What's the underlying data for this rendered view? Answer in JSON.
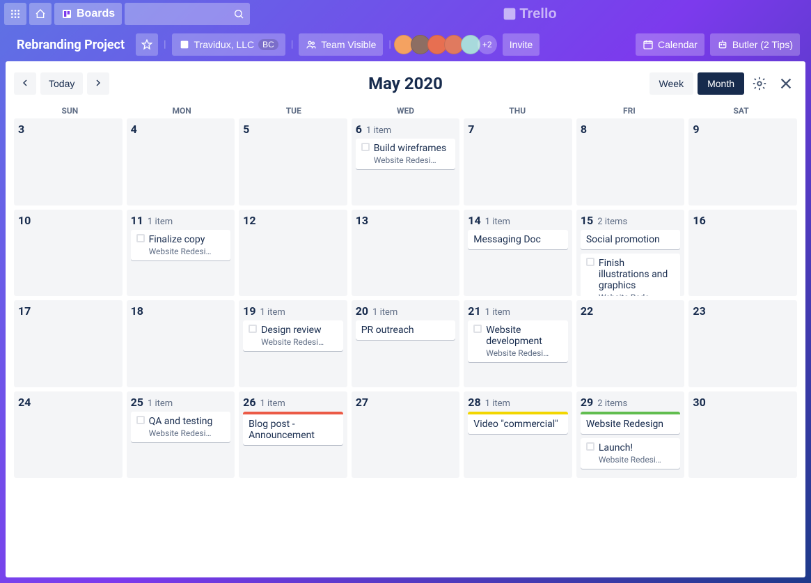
{
  "nav": {
    "boards_label": "Boards",
    "logo_text": "Trello"
  },
  "board_header": {
    "title": "Rebranding Project",
    "workspace": "Travidux, LLC",
    "workspace_badge": "BC",
    "team_visible": "Team Visible",
    "extra_members": "+2",
    "invite": "Invite",
    "calendar_label": "Calendar",
    "butler_label": "Butler (2 Tips)"
  },
  "calendar": {
    "today_label": "Today",
    "month_title": "May 2020",
    "week_label": "Week",
    "month_label": "Month",
    "days": [
      "SUN",
      "MON",
      "TUE",
      "WED",
      "THU",
      "FRI",
      "SAT"
    ],
    "cells": [
      {
        "num": "3"
      },
      {
        "num": "4"
      },
      {
        "num": "5"
      },
      {
        "num": "6",
        "count": "1 item",
        "cards": [
          {
            "chk": true,
            "title": "Build wireframes",
            "board": "Website Redesi…"
          }
        ]
      },
      {
        "num": "7"
      },
      {
        "num": "8"
      },
      {
        "num": "9"
      },
      {
        "num": "10"
      },
      {
        "num": "11",
        "count": "1 item",
        "cards": [
          {
            "chk": true,
            "title": "Finalize copy",
            "board": "Website Redesi…"
          }
        ]
      },
      {
        "num": "12"
      },
      {
        "num": "13"
      },
      {
        "num": "14",
        "count": "1 item",
        "cards": [
          {
            "title": "Messaging Doc"
          }
        ]
      },
      {
        "num": "15",
        "count": "2 items",
        "cards": [
          {
            "title": "Social promotion"
          },
          {
            "chk": true,
            "title": "Finish illustrations and graphics",
            "board": "Website Rede…"
          }
        ]
      },
      {
        "num": "16"
      },
      {
        "num": "17"
      },
      {
        "num": "18"
      },
      {
        "num": "19",
        "count": "1 item",
        "cards": [
          {
            "chk": true,
            "title": "Design review",
            "board": "Website Redesi…"
          }
        ]
      },
      {
        "num": "20",
        "count": "1 item",
        "cards": [
          {
            "title": "PR outreach"
          }
        ]
      },
      {
        "num": "21",
        "count": "1 item",
        "cards": [
          {
            "chk": true,
            "title": "Website development",
            "board": "Website Redesi…"
          }
        ]
      },
      {
        "num": "22"
      },
      {
        "num": "23"
      },
      {
        "num": "24"
      },
      {
        "num": "25",
        "count": "1 item",
        "cards": [
          {
            "chk": true,
            "title": "QA and testing",
            "board": "Website Redesi…"
          }
        ]
      },
      {
        "num": "26",
        "count": "1 item",
        "cards": [
          {
            "cover": "red",
            "title": "Blog post - Announcement"
          }
        ]
      },
      {
        "num": "27"
      },
      {
        "num": "28",
        "count": "1 item",
        "cards": [
          {
            "cover": "yellow",
            "title": "Video \"commercial\""
          }
        ]
      },
      {
        "num": "29",
        "count": "2 items",
        "cards": [
          {
            "cover": "green",
            "title": "Website Redesign"
          },
          {
            "chk": true,
            "title": "Launch!",
            "board": "Website Redesi…"
          }
        ]
      },
      {
        "num": "30"
      }
    ]
  }
}
